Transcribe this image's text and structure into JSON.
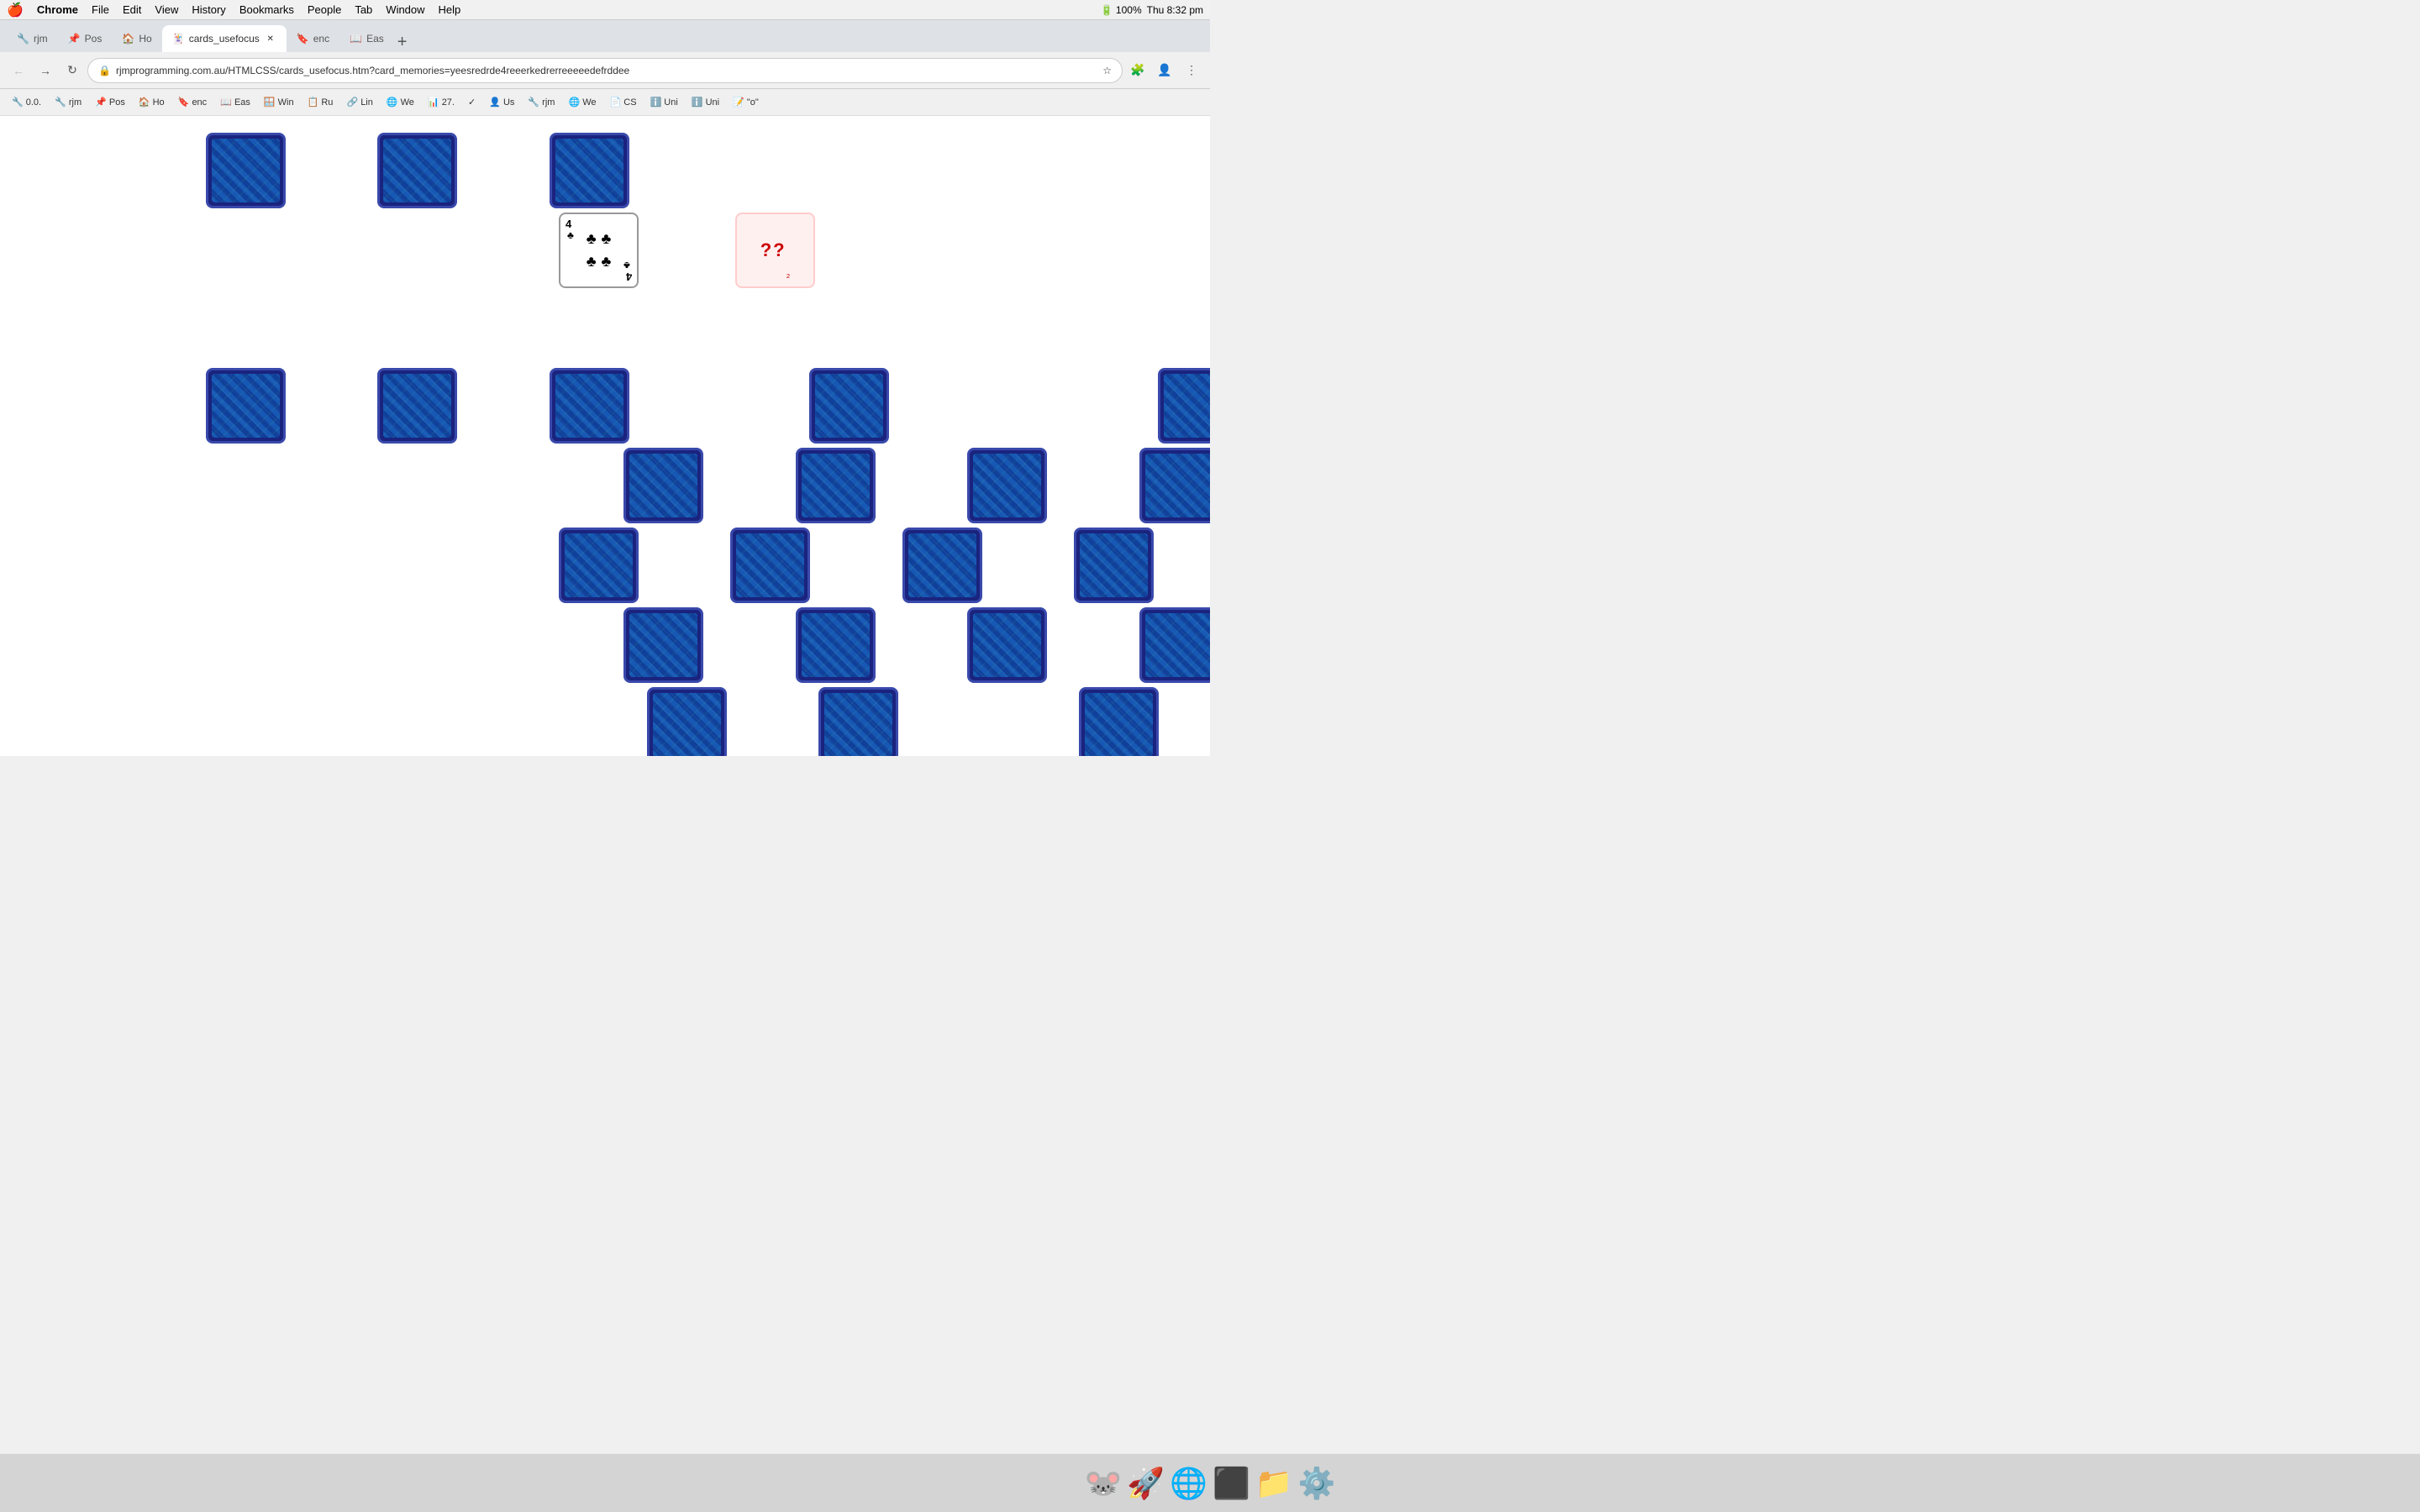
{
  "menubar": {
    "apple": "🍎",
    "items": [
      "Chrome",
      "File",
      "Edit",
      "View",
      "History",
      "Bookmarks",
      "People",
      "Tab",
      "Window",
      "Help"
    ],
    "right": {
      "time": "Thu 8:32 pm",
      "battery": "100%"
    }
  },
  "browser": {
    "url": "rjmprogramming.com.au/HTMLCSS/cards_usefocus.htm?card_memories=yeesredrde4reeerkedrerreeeeedefrddee",
    "tabs": [
      {
        "label": "rjm",
        "active": false,
        "favicon": "🔧"
      },
      {
        "label": "Pos",
        "active": false,
        "favicon": "📌"
      },
      {
        "label": "Ho",
        "active": false,
        "favicon": "🏠"
      },
      {
        "label": "cards_usefocus",
        "active": true,
        "favicon": "🃏"
      },
      {
        "label": "enc",
        "active": false,
        "favicon": "🔖"
      },
      {
        "label": "Eas",
        "active": false,
        "favicon": "📖"
      }
    ],
    "bookmarks": [
      {
        "label": "0.0.",
        "favicon": "🔧"
      },
      {
        "label": "rjm",
        "favicon": "🔧"
      },
      {
        "label": "Pos",
        "favicon": "📌"
      },
      {
        "label": "Ho",
        "favicon": "🏠"
      },
      {
        "label": "enc",
        "favicon": "🔖"
      },
      {
        "label": "Eas",
        "favicon": "📖"
      },
      {
        "label": "Win",
        "favicon": "🪟"
      },
      {
        "label": "Ru",
        "favicon": "📋"
      },
      {
        "label": "Lin",
        "favicon": "🔗"
      },
      {
        "label": "We",
        "favicon": "🌐"
      },
      {
        "label": "27.",
        "favicon": "📊"
      },
      {
        "label": "✓",
        "favicon": "✓"
      },
      {
        "label": "Us",
        "favicon": "👤"
      },
      {
        "label": "rjm",
        "favicon": "🔧"
      },
      {
        "label": "We",
        "favicon": "🌐"
      },
      {
        "label": "CS",
        "favicon": "📄"
      },
      {
        "label": "Uni",
        "favicon": "ℹ️"
      },
      {
        "label": "Uni",
        "favicon": "ℹ️"
      },
      {
        "label": "\"o\"",
        "favicon": "📝"
      }
    ]
  },
  "game": {
    "question_marks": "?? ₂",
    "revealed_card": {
      "value": "4",
      "suit": "♣",
      "pips": 4
    }
  }
}
